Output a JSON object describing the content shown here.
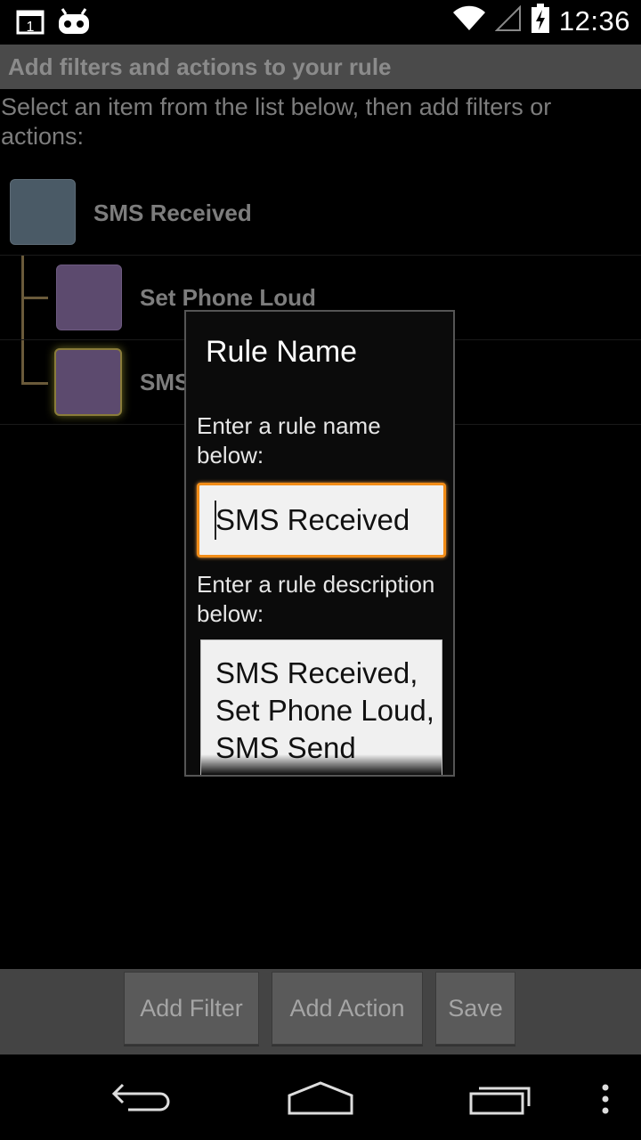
{
  "status_bar": {
    "time": "12:36",
    "notification_badge": "1",
    "icons": [
      "calendar-notification-icon",
      "android-robot-icon",
      "wifi-icon",
      "signal-icon",
      "battery-charging-icon"
    ]
  },
  "app": {
    "title": "Add filters and actions to your rule",
    "instructions": "Select an item from the list below, then add filters or actions:",
    "tree": [
      {
        "label": "SMS Received",
        "kind": "trigger",
        "color": "#4a5a66"
      },
      {
        "label": "Set Phone Loud",
        "kind": "action",
        "color": "#5c4a6e"
      },
      {
        "label": "SMS Send",
        "kind": "action",
        "color": "#5c4a6e",
        "selected": true
      }
    ],
    "buttons": {
      "add_filter": "Add Filter",
      "add_action": "Add Action",
      "save": "Save"
    }
  },
  "dialog": {
    "title": "Rule Name",
    "name_label": "Enter a rule name below:",
    "name_value": "SMS Received",
    "description_label": "Enter a rule description below:",
    "description_value": "SMS Received, Set Phone Loud, SMS Send"
  },
  "nav_bar": {
    "icons": [
      "back-icon",
      "home-icon",
      "recents-icon",
      "overflow-menu-icon"
    ]
  },
  "colors": {
    "accent": "#f28d18",
    "title_bar": "#4a4a4a",
    "button_bar": "#444444"
  }
}
